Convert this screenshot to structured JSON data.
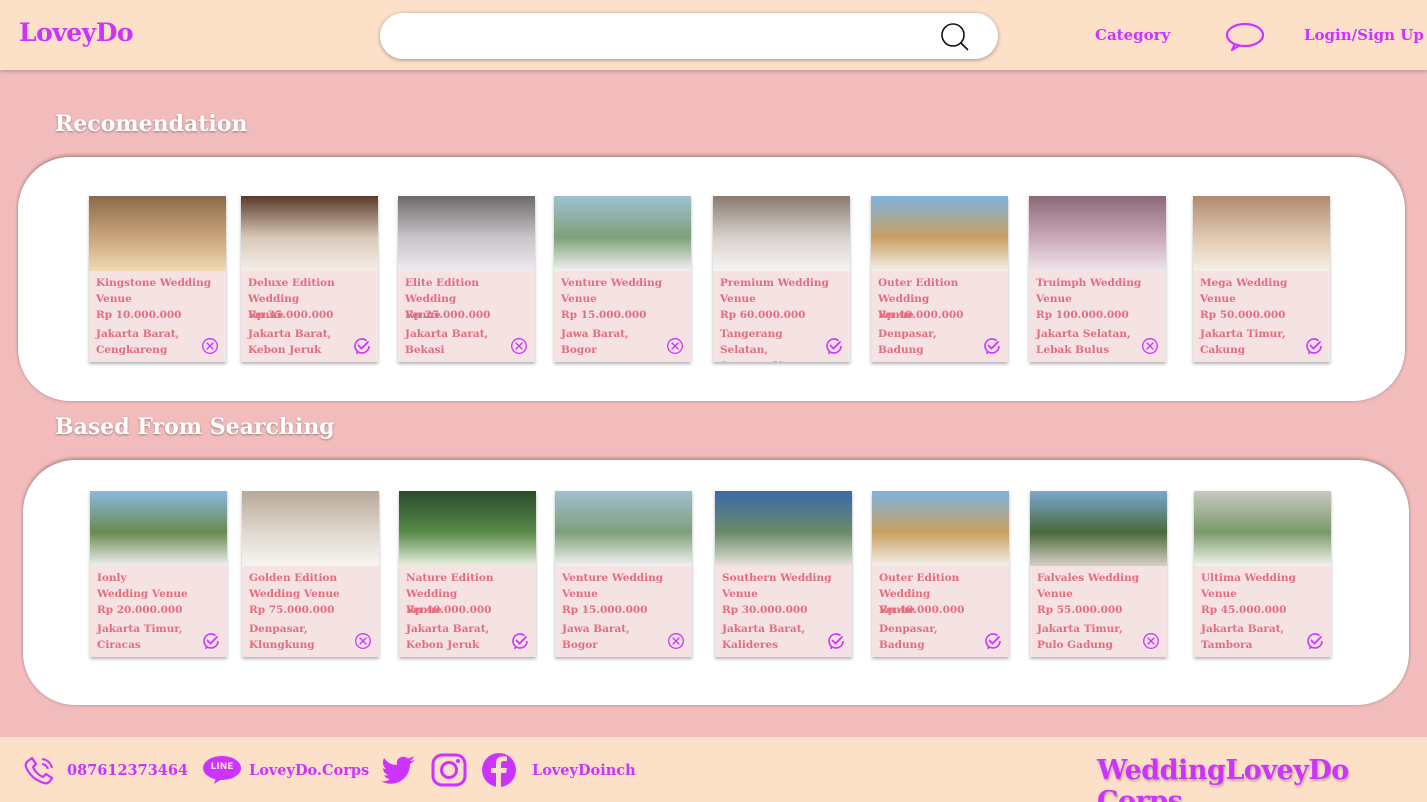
{
  "header": {
    "logo": "LoveyDo",
    "search_placeholder": "",
    "category_label": "Category",
    "login_label": "Login/Sign Up"
  },
  "sections": {
    "recommendation_title": "Recomendation",
    "searching_title": "Based  From Searching"
  },
  "recommendation": [
    {
      "name": "Kingstone Wedding\nVenue",
      "price": "Rp 10.000.000",
      "location": "Jakarta Barat,\nCengkareng",
      "status": "unavailable",
      "colors": [
        "#8a6a4a",
        "#c9a57a",
        "#f0d9b5"
      ]
    },
    {
      "name": "Deluxe Edition Wedding\nVenue",
      "price": "Rp 35.000.000",
      "location": "Jakarta Barat,\nKebon Jeruk",
      "status": "available",
      "colors": [
        "#5a3a2a",
        "#d8c8b8",
        "#f5eee8"
      ]
    },
    {
      "name": "Elite Edition Wedding\nVenue",
      "price": "Rp 25.000.000",
      "location": "Jakarta Barat,\nBekasi",
      "status": "unavailable",
      "colors": [
        "#6f6a6a",
        "#c9c4c8",
        "#eeeaf0"
      ]
    },
    {
      "name": "Venture  Wedding\nVenue",
      "price": "Rp 15.000.000",
      "location": "Jawa Barat,\nBogor",
      "status": "unavailable",
      "colors": [
        "#9fc0d0",
        "#7fa07a",
        "#f2f2f2"
      ]
    },
    {
      "name": "Premium  Wedding\nVenue",
      "price": "Rp 60.000.000",
      "location": "Tangerang Selatan,\nSerpong Utara",
      "status": "available",
      "colors": [
        "#8a7a70",
        "#d8d0cc",
        "#f7f4f2"
      ]
    },
    {
      "name": "Outer Edition  Wedding\nVenue",
      "price": "Rp 40.000.000",
      "location": "Denpasar,\nBadung",
      "status": "available",
      "colors": [
        "#7fb3e0",
        "#c8a060",
        "#f3f0ea"
      ]
    },
    {
      "name": "Truimph  Wedding\nVenue",
      "price": "Rp 100.000.000",
      "location": "Jakarta Selatan,\nLebak Bulus",
      "status": "unavailable",
      "colors": [
        "#8a6a78",
        "#c9a8b8",
        "#f0e4ea"
      ]
    },
    {
      "name": "Mega Wedding\nVenue",
      "price": "Rp 50.000.000",
      "location": "Jakarta Timur,\nCakung",
      "status": "available",
      "colors": [
        "#b08a70",
        "#e0c8b0",
        "#f7efe6"
      ]
    }
  ],
  "searching": [
    {
      "name": "Ionly\nWedding Venue",
      "price": "Rp 20.000.000",
      "location": "Jakarta Timur,\nCiracas",
      "status": "available",
      "colors": [
        "#8ab8e0",
        "#6a8a50",
        "#f0f0f0"
      ]
    },
    {
      "name": "Golden Edition\nWedding Venue",
      "price": "Rp 75.000.000",
      "location": "Denpasar,\nKlungkung",
      "status": "unavailable",
      "colors": [
        "#b8a898",
        "#e0d8d0",
        "#f7f4f0"
      ]
    },
    {
      "name": "Nature Edition Wedding\nVenue",
      "price": "Rp 40.000.000",
      "location": "Jakarta Barat,\nKebon Jeruk",
      "status": "available",
      "colors": [
        "#2a4a2a",
        "#5a8a4a",
        "#e8f0e0"
      ]
    },
    {
      "name": "Venture  Wedding\nVenue",
      "price": "Rp 15.000.000",
      "location": "Jawa Barat,\nBogor",
      "status": "unavailable",
      "colors": [
        "#9fc0d0",
        "#7fa07a",
        "#f2f2f2"
      ]
    },
    {
      "name": "Southern  Wedding\nVenue",
      "price": "Rp 30.000.000",
      "location": "Jakarta Barat,\nKalideres",
      "status": "available",
      "colors": [
        "#3a6aa8",
        "#6a8a6a",
        "#e8e4dc"
      ]
    },
    {
      "name": "Outer Edition  Wedding\nVenue",
      "price": "Rp 40.000.000",
      "location": "Denpasar,\nBadung",
      "status": "available",
      "colors": [
        "#7fb3e0",
        "#c8a060",
        "#f3f0ea"
      ]
    },
    {
      "name": "Falvales  Wedding\nVenue",
      "price": "Rp 55.000.000",
      "location": "Jakarta Timur,\nPulo Gadung",
      "status": "unavailable",
      "colors": [
        "#7aa8d0",
        "#4a6a3a",
        "#d8d0c8"
      ]
    },
    {
      "name": "Ultima Wedding\nVenue",
      "price": "Rp 45.000.000",
      "location": "Jakarta Barat,\nTambora",
      "status": "available",
      "colors": [
        "#c8c8c0",
        "#7a9a6a",
        "#f4f4f0"
      ]
    }
  ],
  "footer": {
    "phone": "087612373464",
    "line_label": "LINE",
    "line_id": "LoveyDo.Corps",
    "facebook": "LoveyDoinch",
    "brand": "WeddingLoveyDo Corps"
  },
  "colors": {
    "accent": "#cc33ff",
    "card_text": "#e36d7f",
    "header_bg": "#fde0c8",
    "page_bg": "#f2bcbc"
  },
  "icons": {
    "search": "search-icon",
    "chat": "chat-bubble-icon",
    "phone": "phone-icon",
    "line": "line-icon",
    "twitter": "twitter-icon",
    "instagram": "instagram-icon",
    "facebook": "facebook-icon",
    "available": "check-circle-icon",
    "unavailable": "x-circle-icon"
  }
}
